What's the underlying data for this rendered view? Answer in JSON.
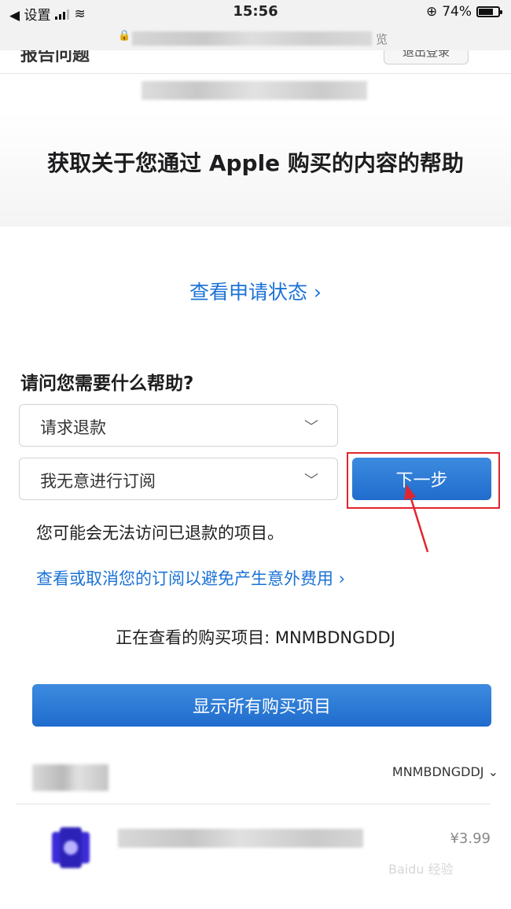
{
  "status_bar": {
    "back_app": "◀ 设置",
    "time": "15:56",
    "battery": "74%",
    "battery_level": 0.74
  },
  "url_bar": {
    "suffix": "览"
  },
  "header": {
    "title": "报告问题",
    "sign_out": "退出登录"
  },
  "hero": {
    "title": "获取关于您通过 Apple 购买的内容的帮助"
  },
  "request_status_link": "查看申请状态 ›",
  "question": "请问您需要什么帮助?",
  "reason_select": {
    "value": "请求退款"
  },
  "detail_select": {
    "value": "我无意进行订阅"
  },
  "next_button": "下一步",
  "note": "您可能会无法访问已退款的项目。",
  "manage_subscriptions_link": "查看或取消您的订阅以避免产生意外费用 ›",
  "viewing": "正在查看的购买项目: MNMBDNGDDJ",
  "show_all_button": "显示所有购买项目",
  "purchase": {
    "order_id": "MNMBDNGDDJ ⌄",
    "price": "¥3.99"
  },
  "watermark": "Baidu 经验",
  "colors": {
    "link": "#1b72d6",
    "button": "#1f6ccd",
    "highlight": "#e0262e"
  }
}
